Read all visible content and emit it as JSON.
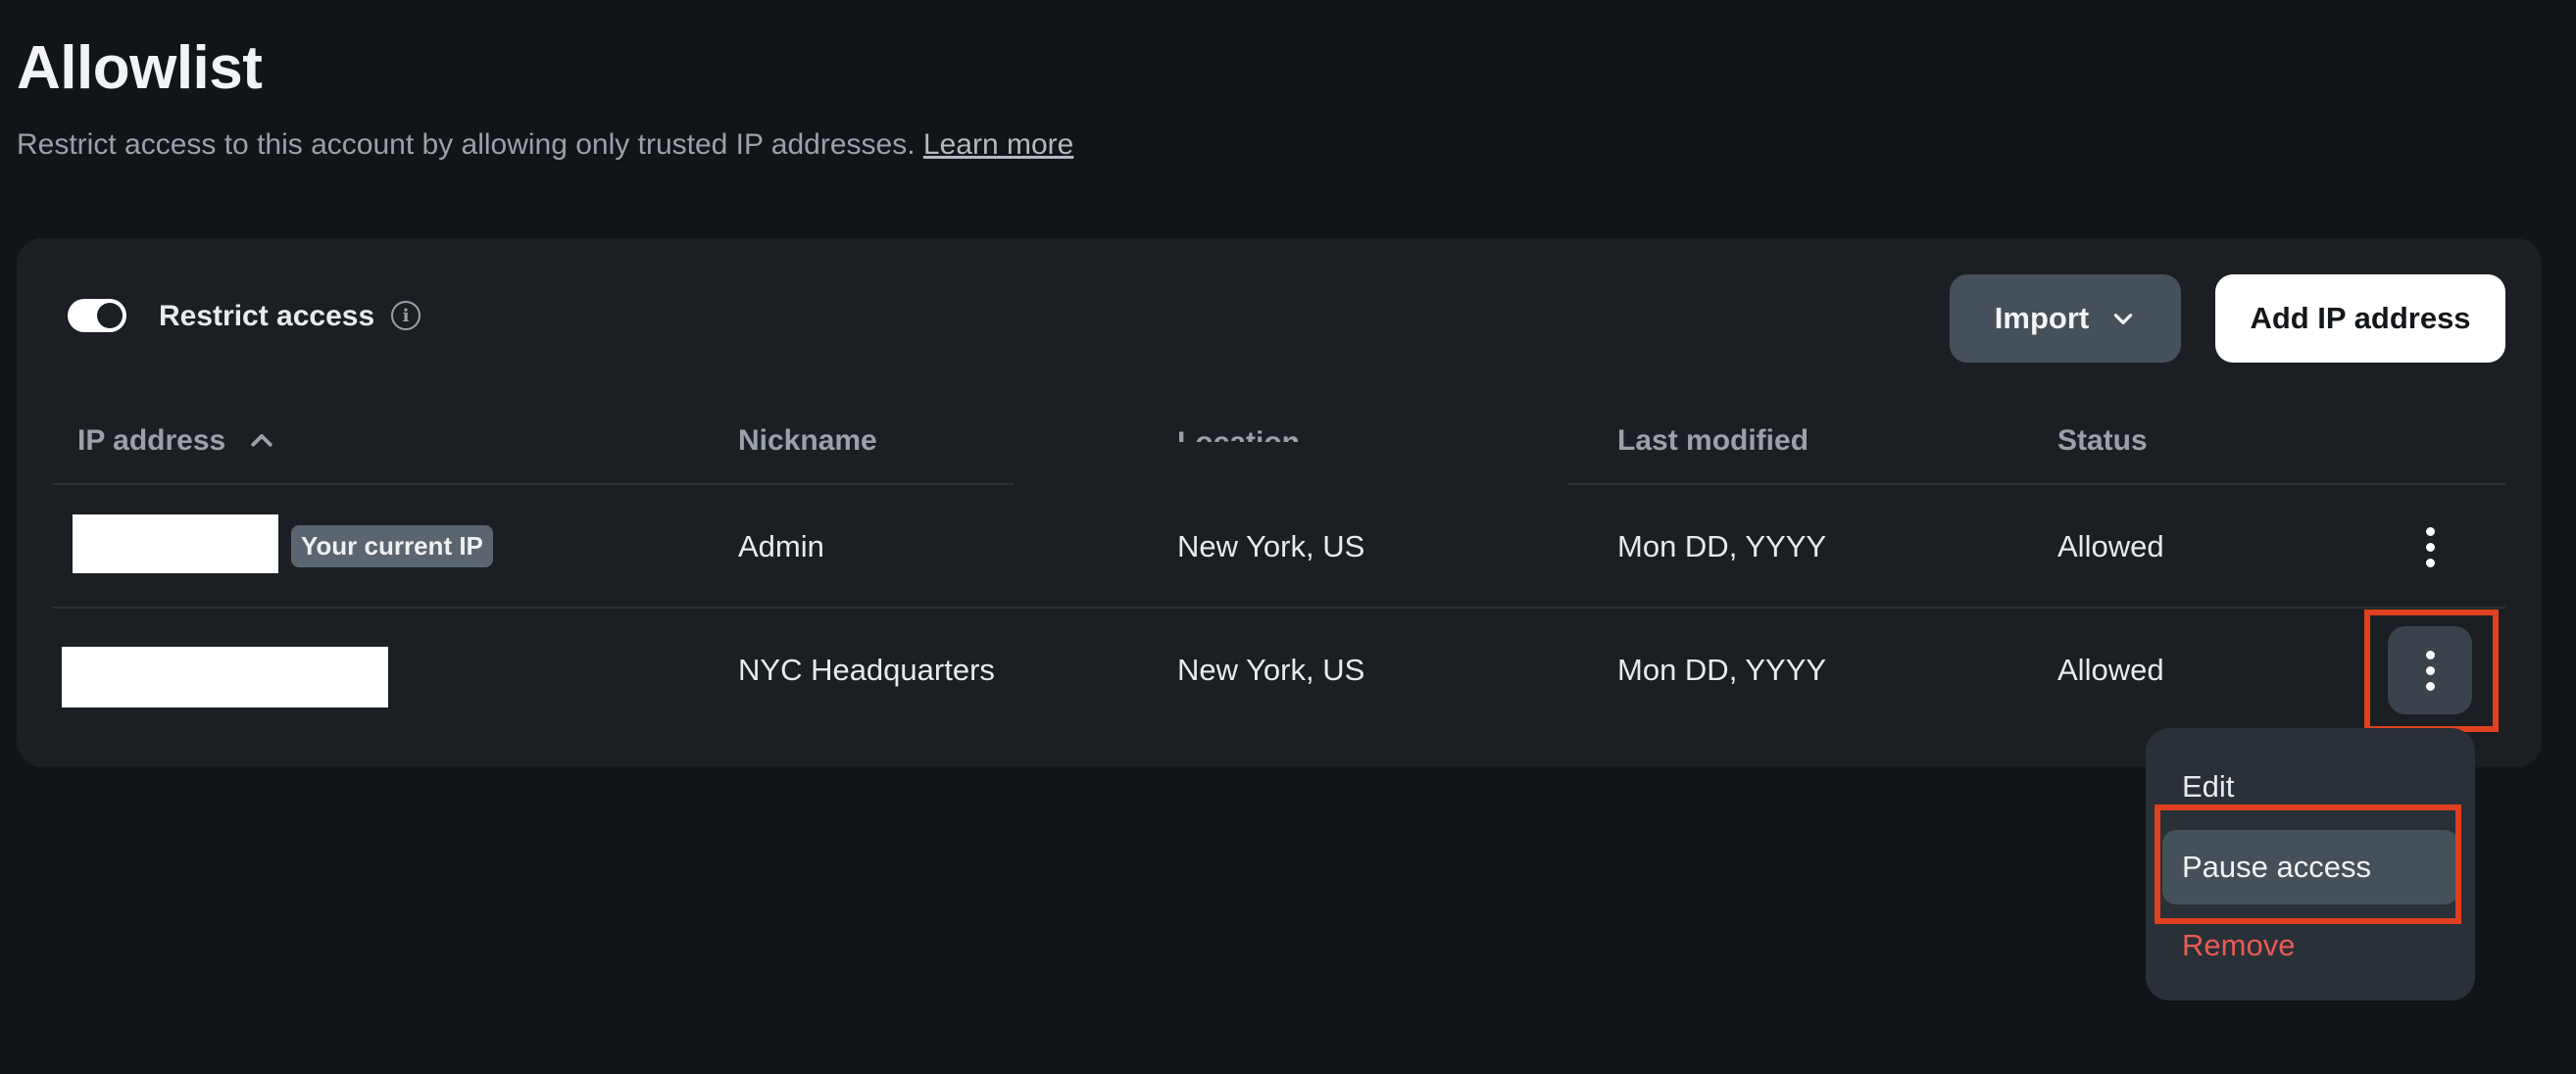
{
  "header": {
    "title": "Allowlist",
    "subtitle": "Restrict access to this account by allowing only trusted IP addresses.",
    "learn_more": "Learn more"
  },
  "controls": {
    "restrict_label": "Restrict access",
    "restrict_enabled": true,
    "info_glyph": "i",
    "import_label": "Import",
    "add_label": "Add IP address"
  },
  "table": {
    "columns": {
      "ip": "IP address",
      "nickname": "Nickname",
      "location": "Location",
      "last_modified": "Last modified",
      "status": "Status"
    },
    "sort": {
      "column": "IP address",
      "direction": "ascending"
    },
    "rows": [
      {
        "ip": "",
        "badge": "Your current IP",
        "nickname": "Admin",
        "location": "New York, US",
        "last_modified": "Mon DD, YYYY",
        "status": "Allowed"
      },
      {
        "ip": "",
        "nickname": "NYC Headquarters",
        "location": "New York, US",
        "last_modified": "Mon DD, YYYY",
        "status": "Allowed"
      }
    ]
  },
  "row_menu": {
    "items": [
      "Edit",
      "Pause access",
      "Remove"
    ],
    "highlighted": "Pause access"
  },
  "colors": {
    "background": "#111418",
    "card": "#1b1f23",
    "highlight": "#e0401f",
    "danger": "#e65b52"
  },
  "icons": {
    "info": "info-icon",
    "import_chevron": "chevron-down-icon",
    "sort": "chevron-up-icon",
    "row_actions": "more-vertical-icon"
  }
}
